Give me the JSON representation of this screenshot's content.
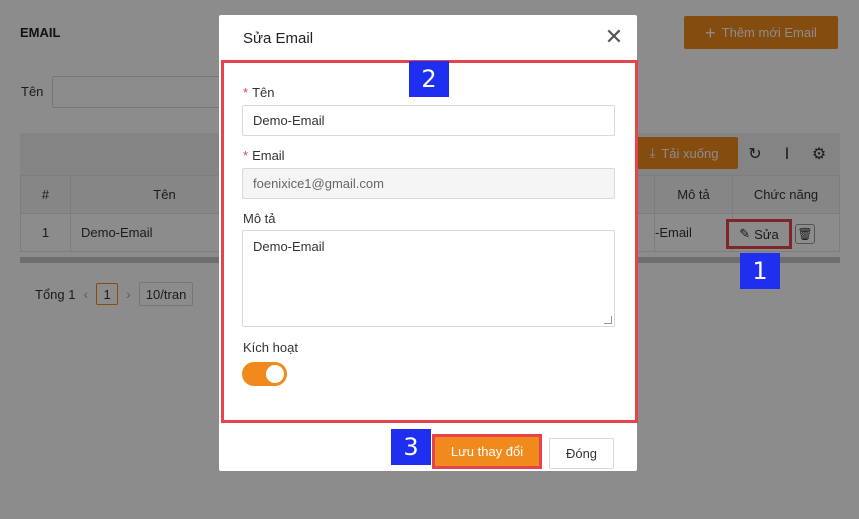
{
  "page": {
    "title": "EMAIL",
    "add_button": "Thêm mới Email",
    "filter_label": "Tên",
    "download_button": "Tải xuống",
    "table": {
      "headers": [
        "#",
        "Tên",
        "Mô tả",
        "Chức năng"
      ],
      "rows": [
        {
          "index": "1",
          "name": "Demo-Email",
          "description": "-Email"
        }
      ]
    },
    "edit_label": "Sửa",
    "pager": {
      "total": "Tổng 1",
      "current_page": "1",
      "page_size": "10/tran"
    }
  },
  "modal": {
    "title": "Sửa Email",
    "fields": {
      "name_label": "Tên",
      "name_value": "Demo-Email",
      "email_label": "Email",
      "email_value": "foenixice1@gmail.com",
      "description_label": "Mô tả",
      "description_value": "Demo-Email",
      "active_label": "Kích hoạt"
    },
    "active": true,
    "save_button": "Lưu thay đổi",
    "close_button": "Đóng"
  },
  "badges": [
    "1",
    "2",
    "3"
  ],
  "colors": {
    "accent": "#f08a1d",
    "highlight": "#e8434a",
    "badge": "#1f2ff0"
  },
  "icons": [
    "plus-icon",
    "download-icon",
    "refresh-icon",
    "column-icon",
    "settings-icon",
    "edit-icon",
    "delete-icon",
    "close-icon",
    "chevron-left-icon",
    "chevron-right-icon"
  ]
}
